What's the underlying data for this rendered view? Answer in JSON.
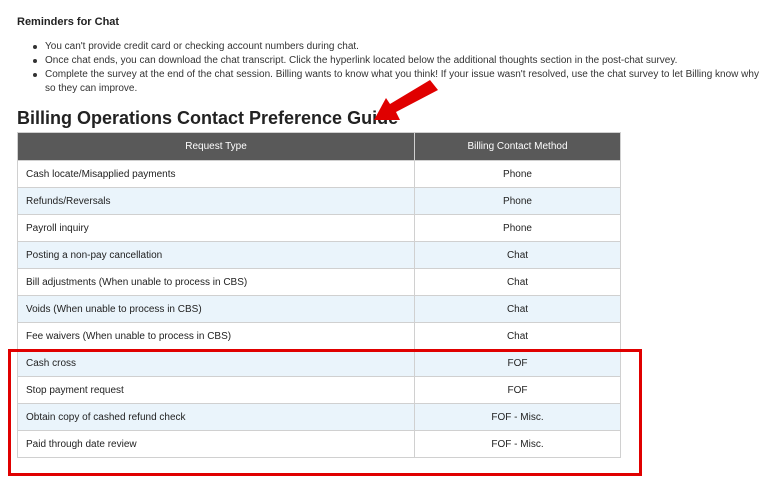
{
  "reminders": {
    "title": "Reminders for Chat",
    "items": [
      "You can't provide credit card or checking account numbers during chat.",
      "Once chat ends, you can download the chat transcript.  Click the hyperlink located below the additional thoughts section in the post-chat survey.",
      "Complete the survey at the end of the chat session.  Billing wants to know what you think!  If your issue wasn't resolved, use the chat survey to let Billing know why so they can improve."
    ]
  },
  "guide": {
    "title": "Billing Operations Contact Preference Guide",
    "headers": [
      "Request Type",
      "Billing Contact Method"
    ],
    "rows": [
      {
        "type": "Cash locate/Misapplied payments",
        "method": "Phone"
      },
      {
        "type": "Refunds/Reversals",
        "method": "Phone"
      },
      {
        "type": "Payroll inquiry",
        "method": "Phone"
      },
      {
        "type": "Posting a non-pay cancellation",
        "method": "Chat"
      },
      {
        "type": "Bill adjustments (When unable to process in CBS)",
        "method": "Chat"
      },
      {
        "type": "Voids (When unable to process in CBS)",
        "method": "Chat"
      },
      {
        "type": "Fee waivers (When unable to process in CBS)",
        "method": "Chat"
      },
      {
        "type": "Cash cross",
        "method": "FOF"
      },
      {
        "type": "Stop payment request",
        "method": "FOF"
      },
      {
        "type": "Obtain copy of cashed refund check",
        "method": "FOF - Misc."
      },
      {
        "type": "Paid through date review",
        "method": "FOF - Misc."
      }
    ]
  },
  "colors": {
    "header_bg": "#595959",
    "alt_row_bg": "#eaf4fb",
    "annotation_red": "#e00000"
  },
  "icons": {
    "annotation_arrow": "red-arrow-icon"
  }
}
